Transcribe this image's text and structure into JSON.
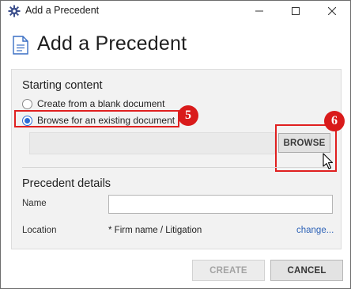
{
  "window": {
    "title": "Add a Precedent"
  },
  "header": {
    "title": "Add a Precedent",
    "icon": "document-icon"
  },
  "starting_content": {
    "section_title": "Starting content",
    "options": [
      {
        "label": "Create from a blank document",
        "selected": false
      },
      {
        "label": "Browse for an existing document",
        "selected": true
      }
    ],
    "path_value": "",
    "browse_label": "BROWSE"
  },
  "callouts": {
    "step_5": "5",
    "step_6": "6",
    "color": "#d91b1b"
  },
  "details": {
    "section_title": "Precedent details",
    "name_label": "Name",
    "name_value": "",
    "location_label": "Location",
    "location_value": "* Firm name / Litigation",
    "change_link": "change..."
  },
  "footer": {
    "create_label": "CREATE",
    "cancel_label": "CANCEL"
  },
  "colors": {
    "accent": "#2b6cd6",
    "link": "#2f64b8",
    "highlight": "#e02020"
  }
}
